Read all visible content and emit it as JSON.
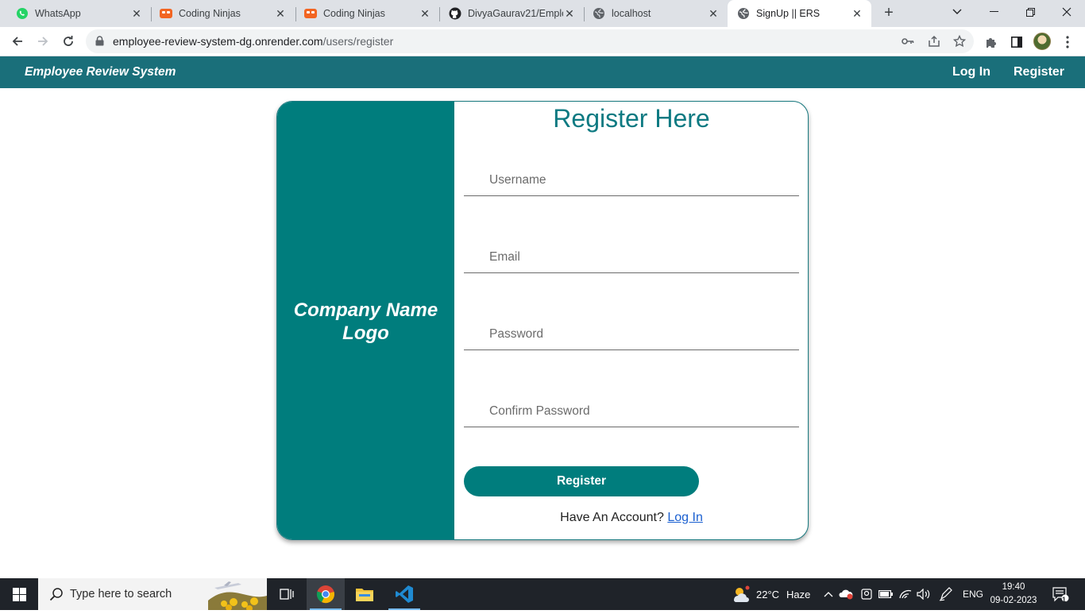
{
  "browser": {
    "tabs": [
      {
        "title": "WhatsApp",
        "icon": "whatsapp-icon",
        "color": "#25d366"
      },
      {
        "title": "Coding Ninjas",
        "icon": "coding-ninjas-icon",
        "color": "#f26522"
      },
      {
        "title": "Coding Ninjas",
        "icon": "coding-ninjas-icon",
        "color": "#f26522"
      },
      {
        "title": "DivyaGaurav21/Emplo",
        "icon": "github-icon",
        "color": "#202124"
      },
      {
        "title": "localhost",
        "icon": "globe-icon",
        "color": "#5f6368"
      },
      {
        "title": "SignUp || ERS",
        "icon": "globe-icon",
        "color": "#5f6368",
        "active": true
      }
    ],
    "url_host": "employee-review-system-dg.onrender.com",
    "url_path": "/users/register"
  },
  "app": {
    "brand": "Employee Review System",
    "nav": {
      "login": "Log In",
      "register": "Register"
    },
    "accent_color": "#1a6f7a"
  },
  "card": {
    "logo_text_line1": "Company Name",
    "logo_text_line2": "Logo",
    "title": "Register Here",
    "fields": {
      "username_placeholder": "Username",
      "email_placeholder": "Email",
      "password_placeholder": "Password",
      "confirm_password_placeholder": "Confirm Password"
    },
    "submit_label": "Register",
    "have_account_text": "Have An Account?",
    "login_link": "Log In",
    "accent_color": "#007d7d"
  },
  "taskbar": {
    "search_placeholder": "Type here to search",
    "weather_temp": "22°C",
    "weather_desc": "Haze",
    "language": "ENG",
    "time": "19:40",
    "date": "09-02-2023",
    "notification_count": "1"
  }
}
